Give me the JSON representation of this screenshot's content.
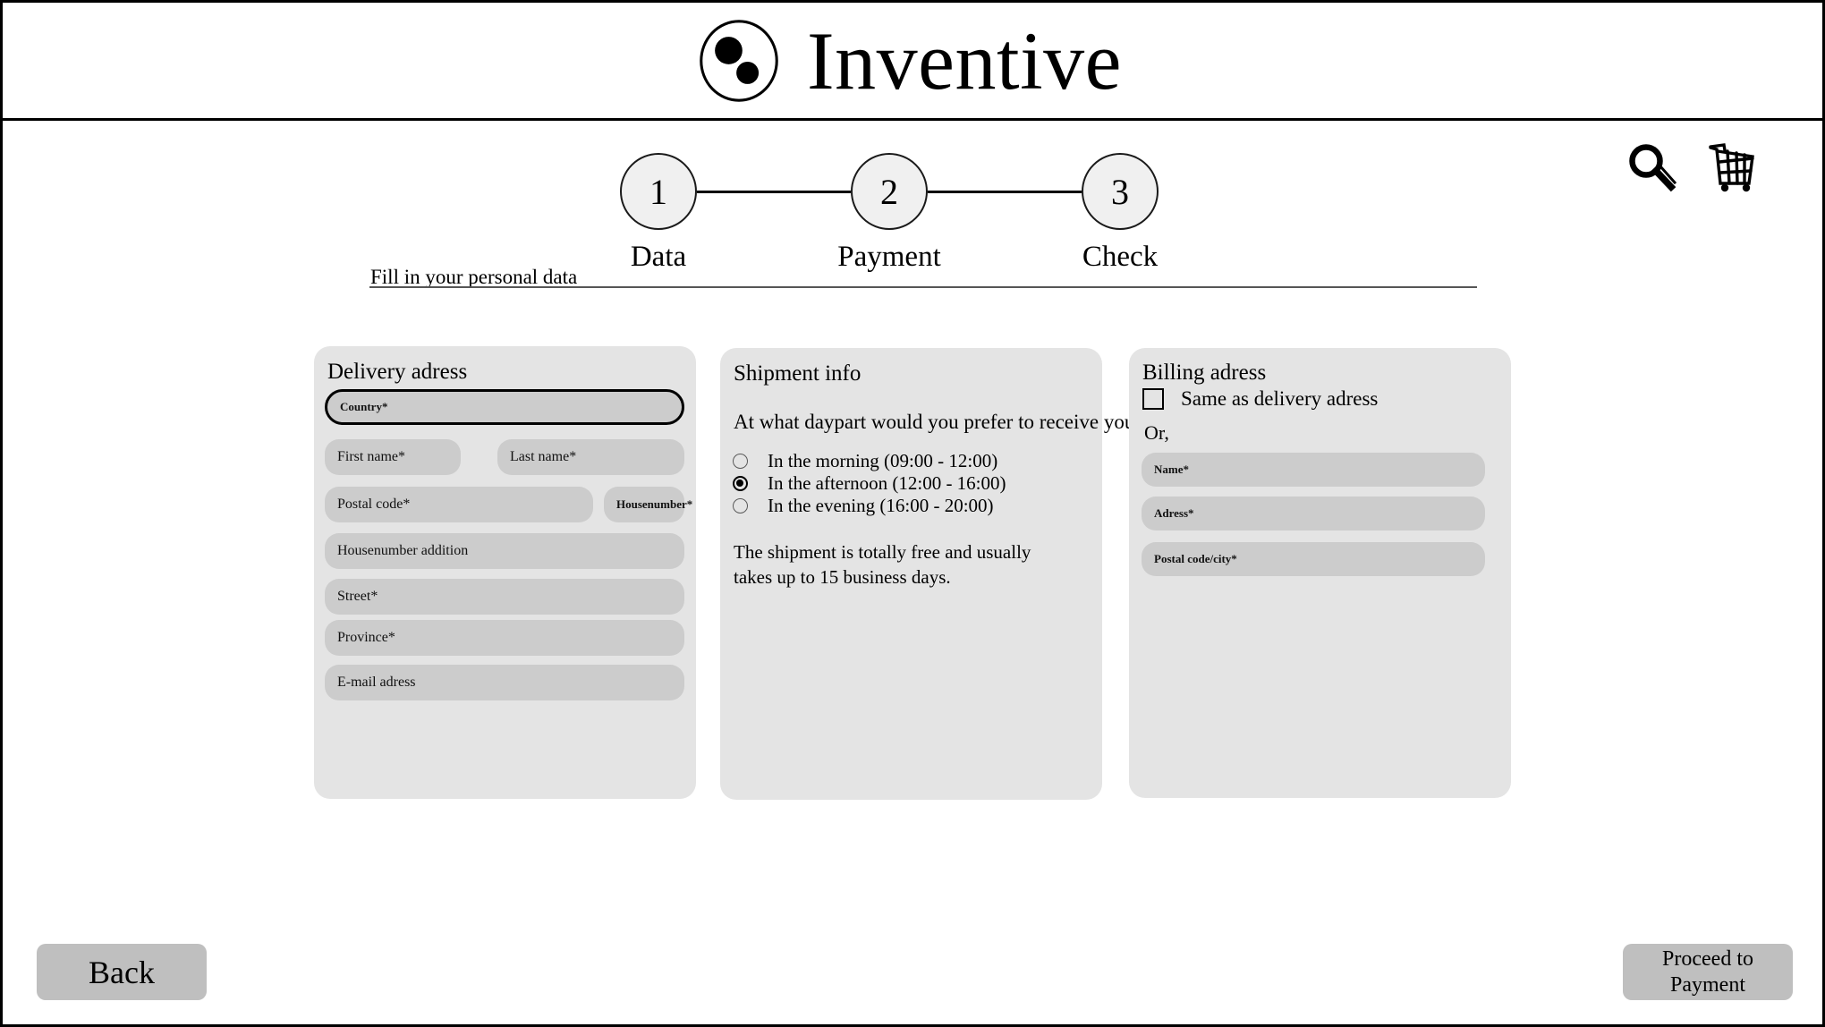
{
  "header": {
    "brand_name": "Inventive",
    "logo_icon": "inventive-circles-logo"
  },
  "top_icons": [
    {
      "name": "search-icon",
      "label": "Search"
    },
    {
      "name": "shopping-cart-icon",
      "label": "Shopping cart"
    }
  ],
  "stepper": {
    "steps": [
      {
        "number": "1",
        "label": "Data"
      },
      {
        "number": "2",
        "label": "Payment"
      },
      {
        "number": "3",
        "label": "Check"
      }
    ]
  },
  "section": {
    "caption": "Fill in your personal data"
  },
  "delivery": {
    "title": "Delivery adress",
    "fields": [
      {
        "label": "Country*",
        "value": "",
        "focused": true
      },
      {
        "label": "First name*",
        "value": "",
        "focused": false
      },
      {
        "label": "Last name*",
        "value": "",
        "focused": false
      },
      {
        "label": "Postal code*",
        "value": "",
        "focused": false
      },
      {
        "label": "Housenumber*",
        "value": "",
        "focused": false
      },
      {
        "label": "Housenumber addition",
        "value": "",
        "focused": false
      },
      {
        "label": "Street*",
        "value": "",
        "focused": false
      },
      {
        "label": "Province*",
        "value": "",
        "focused": false
      },
      {
        "label": "E-mail adress",
        "value": "",
        "focused": false
      }
    ]
  },
  "shipment": {
    "title": "Shipment info",
    "question": "At what daypart would you prefer to receive your delivery?",
    "options": [
      {
        "label": "In the morning (09:00 - 12:00)",
        "selected": false
      },
      {
        "label": "In the afternoon (12:00 - 16:00)",
        "selected": true
      },
      {
        "label": "In the evening (16:00 - 20:00)",
        "selected": false
      }
    ],
    "note": "The shipment is totally free and usually takes up to 15 business days."
  },
  "billing": {
    "title": "Billing adress",
    "same_as_delivery_label": "Same as delivery adress",
    "same_as_delivery_checked": false,
    "or_text": "Or,",
    "fields": [
      {
        "label": "Name*",
        "value": ""
      },
      {
        "label": "Adress*",
        "value": ""
      },
      {
        "label": "Postal code/city*",
        "value": ""
      }
    ]
  },
  "footer": {
    "back_label": "Back",
    "proceed_line1": "Proceed to",
    "proceed_line2": "Payment"
  },
  "colors": {
    "page_bg": "#ffffff",
    "panel_bg": "#e4e4e4",
    "field_bg": "#cccccc",
    "button_bg": "#bfbfbf",
    "step_circle_bg": "#f0f0f0",
    "outline": "#000000"
  }
}
